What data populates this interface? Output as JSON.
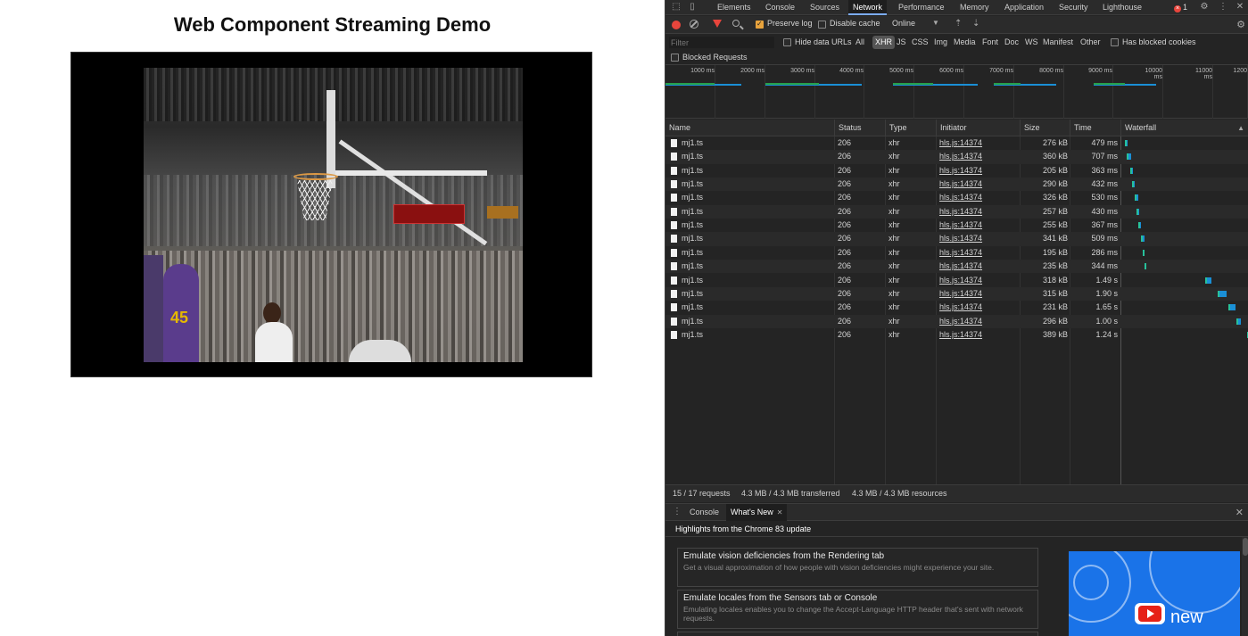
{
  "page": {
    "title": "Web Component Streaming Demo"
  },
  "video": {
    "jersey_number": "45"
  },
  "devtools": {
    "tabs": [
      "Elements",
      "Console",
      "Sources",
      "Network",
      "Performance",
      "Memory",
      "Application",
      "Security",
      "Lighthouse"
    ],
    "active_tab": "Network",
    "error_count": "1",
    "toolbar": {
      "preserve_log": "Preserve log",
      "preserve_log_checked": true,
      "disable_cache": "Disable cache",
      "throttling": "Online"
    },
    "filter": {
      "placeholder": "Filter",
      "hide_data_urls": "Hide data URLs",
      "types": [
        "All",
        "XHR",
        "JS",
        "CSS",
        "Img",
        "Media",
        "Font",
        "Doc",
        "WS",
        "Manifest",
        "Other"
      ],
      "active_type": "XHR",
      "has_blocked_cookies": "Has blocked cookies",
      "blocked_requests": "Blocked Requests"
    },
    "overview_ticks": [
      "1000 ms",
      "2000 ms",
      "3000 ms",
      "4000 ms",
      "5000 ms",
      "6000 ms",
      "7000 ms",
      "8000 ms",
      "9000 ms",
      "10000 ms",
      "11000 ms",
      "1200"
    ],
    "columns": {
      "name": "Name",
      "status": "Status",
      "type": "Type",
      "initiator": "Initiator",
      "size": "Size",
      "time": "Time",
      "waterfall": "Waterfall"
    },
    "requests": [
      {
        "name": "mj1.ts",
        "status": "206",
        "type": "xhr",
        "initiator": "hls.js:14374",
        "size": "276 kB",
        "time": "479 ms"
      },
      {
        "name": "mj1.ts",
        "status": "206",
        "type": "xhr",
        "initiator": "hls.js:14374",
        "size": "360 kB",
        "time": "707 ms"
      },
      {
        "name": "mj1.ts",
        "status": "206",
        "type": "xhr",
        "initiator": "hls.js:14374",
        "size": "205 kB",
        "time": "363 ms"
      },
      {
        "name": "mj1.ts",
        "status": "206",
        "type": "xhr",
        "initiator": "hls.js:14374",
        "size": "290 kB",
        "time": "432 ms"
      },
      {
        "name": "mj1.ts",
        "status": "206",
        "type": "xhr",
        "initiator": "hls.js:14374",
        "size": "326 kB",
        "time": "530 ms"
      },
      {
        "name": "mj1.ts",
        "status": "206",
        "type": "xhr",
        "initiator": "hls.js:14374",
        "size": "257 kB",
        "time": "430 ms"
      },
      {
        "name": "mj1.ts",
        "status": "206",
        "type": "xhr",
        "initiator": "hls.js:14374",
        "size": "255 kB",
        "time": "367 ms"
      },
      {
        "name": "mj1.ts",
        "status": "206",
        "type": "xhr",
        "initiator": "hls.js:14374",
        "size": "341 kB",
        "time": "509 ms"
      },
      {
        "name": "mj1.ts",
        "status": "206",
        "type": "xhr",
        "initiator": "hls.js:14374",
        "size": "195 kB",
        "time": "286 ms"
      },
      {
        "name": "mj1.ts",
        "status": "206",
        "type": "xhr",
        "initiator": "hls.js:14374",
        "size": "235 kB",
        "time": "344 ms"
      },
      {
        "name": "mj1.ts",
        "status": "206",
        "type": "xhr",
        "initiator": "hls.js:14374",
        "size": "318 kB",
        "time": "1.49 s"
      },
      {
        "name": "mj1.ts",
        "status": "206",
        "type": "xhr",
        "initiator": "hls.js:14374",
        "size": "315 kB",
        "time": "1.90 s"
      },
      {
        "name": "mj1.ts",
        "status": "206",
        "type": "xhr",
        "initiator": "hls.js:14374",
        "size": "231 kB",
        "time": "1.65 s"
      },
      {
        "name": "mj1.ts",
        "status": "206",
        "type": "xhr",
        "initiator": "hls.js:14374",
        "size": "296 kB",
        "time": "1.00 s"
      },
      {
        "name": "mj1.ts",
        "status": "206",
        "type": "xhr",
        "initiator": "hls.js:14374",
        "size": "389 kB",
        "time": "1.24 s"
      }
    ],
    "summary": {
      "requests": "15 / 17 requests",
      "transferred": "4.3 MB / 4.3 MB transferred",
      "resources": "4.3 MB / 4.3 MB resources"
    },
    "drawer": {
      "tabs": [
        "Console",
        "What's New"
      ],
      "active_tab": "What's New",
      "heading": "Highlights from the Chrome 83 update",
      "cards": [
        {
          "title": "Emulate vision deficiencies from the Rendering tab",
          "desc": "Get a visual approximation of how people with vision deficiencies might experience your site."
        },
        {
          "title": "Emulate locales from the Sensors tab or Console",
          "desc": "Emulating locales enables you to change the Accept-Language HTTP header that's sent with network requests."
        }
      ],
      "promo_text": "new"
    },
    "colors": {
      "accent": "#7cacf8",
      "record": "#e8453c",
      "waterfall_bar": "#1a8fd6",
      "background": "#242424"
    }
  }
}
